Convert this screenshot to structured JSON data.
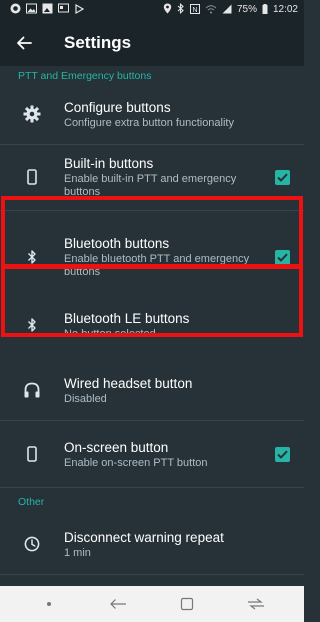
{
  "status_bar": {
    "left_icons": [
      "notification-icon",
      "image-icon",
      "gallery-icon",
      "cast-icon",
      "play-icon"
    ],
    "battery": "75%",
    "time": "12:02"
  },
  "app_bar": {
    "title": "Settings",
    "back_icon": "arrow-left-icon"
  },
  "sections": {
    "top_header": "PTT and Emergency buttons",
    "other_header": "Other"
  },
  "items": [
    {
      "title": "Configure buttons",
      "subtitle": "Configure extra button functionality",
      "icon": "gear-icon",
      "checked": null
    },
    {
      "title": "Built-in buttons",
      "subtitle": "Enable built-in PTT and emergency buttons",
      "icon": "phone-icon",
      "checked": true
    },
    {
      "title": "Bluetooth buttons",
      "subtitle": "Enable bluetooth PTT and emergency buttons",
      "icon": "bluetooth-icon",
      "checked": true
    },
    {
      "title": "Bluetooth LE buttons",
      "subtitle": "No button selected",
      "icon": "bluetooth-icon",
      "checked": null
    },
    {
      "title": "Wired headset button",
      "subtitle": "Disabled",
      "icon": "headset-icon",
      "checked": null
    },
    {
      "title": "On-screen button",
      "subtitle": "Enable on-screen PTT button",
      "icon": "phone-icon",
      "checked": true
    },
    {
      "title": "Disconnect warning repeat",
      "subtitle": "1 min",
      "icon": "clock-icon",
      "checked": null
    }
  ],
  "colors": {
    "accent": "#26b5a5",
    "highlight": "#ee1111",
    "background": "#263238",
    "app_bar": "#1b2429"
  },
  "nav_bar": {
    "items": [
      "dot-icon",
      "back-arrow-icon",
      "recents-icon",
      "overview-icon"
    ]
  }
}
